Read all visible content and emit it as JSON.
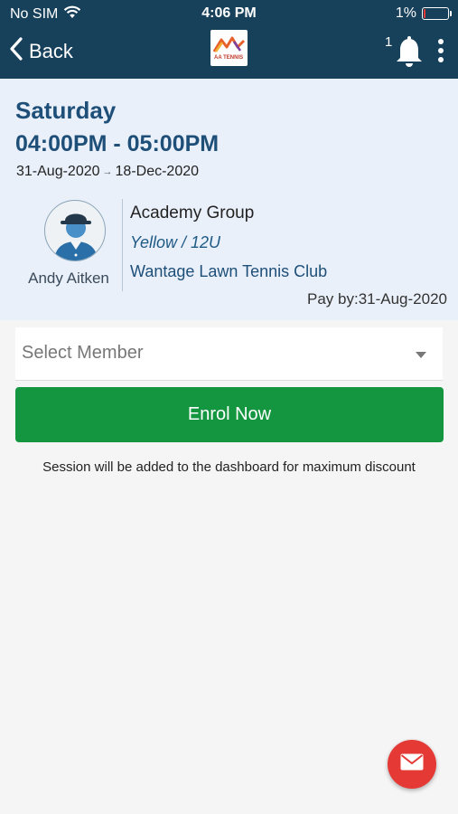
{
  "status_bar": {
    "carrier": "No SIM",
    "time": "4:06 PM",
    "battery_text": "1%",
    "battery_level": 0.01
  },
  "nav": {
    "back_label": "Back",
    "logo_text": "AA TENNIS",
    "notification_count": "1"
  },
  "session": {
    "day": "Saturday",
    "time_range": "04:00PM - 05:00PM",
    "start_date": "31-Aug-2020",
    "end_date": "18-Dec-2020",
    "coach_name": "Andy Aitken",
    "group": "Academy Group",
    "level": "Yellow / 12U",
    "club": "Wantage Lawn Tennis Club",
    "pay_by": "Pay by:31-Aug-2020"
  },
  "member_select": {
    "placeholder": "Select Member"
  },
  "enrol_button": {
    "label": "Enrol Now"
  },
  "note": "Session will be added to the dashboard for maximum discount",
  "colors": {
    "header_bg": "#17405b",
    "card_bg": "#eaf0fa",
    "title_blue": "#1e4f78",
    "enrol_green": "#13963f",
    "fab_red": "#e53935"
  },
  "icons": {
    "wifi": "wifi-icon",
    "back": "chevron-left-icon",
    "bell": "bell-icon",
    "more": "more-vertical-icon",
    "coach": "coach-avatar-icon",
    "dropdown": "caret-down-icon",
    "mail": "mail-icon"
  }
}
